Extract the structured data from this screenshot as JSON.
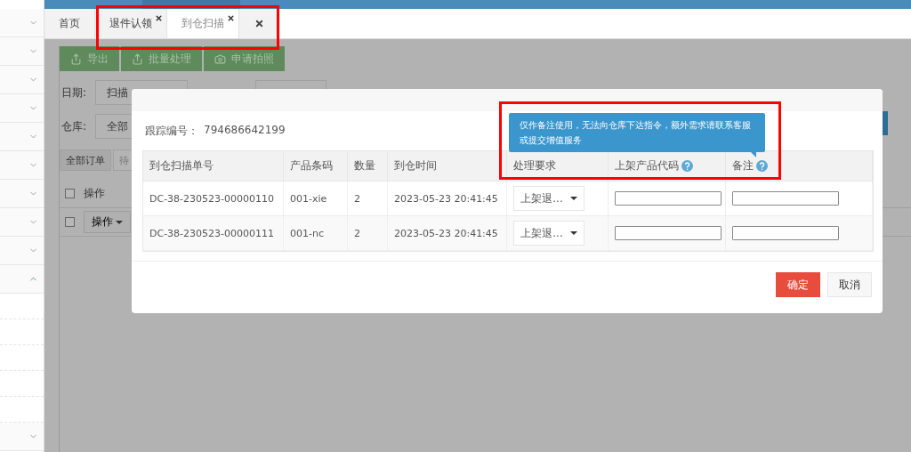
{
  "sidebar": {
    "items": [
      {
        "expanded": false
      },
      {
        "expanded": false
      },
      {
        "expanded": false
      },
      {
        "expanded": false
      },
      {
        "expanded": false
      },
      {
        "expanded": false
      },
      {
        "expanded": false
      },
      {
        "expanded": false
      },
      {
        "expanded": false
      },
      {
        "expanded": true
      },
      {
        "expanded": false
      }
    ]
  },
  "tabs": [
    {
      "label": "首页",
      "selected": false,
      "closable": false
    },
    {
      "label": "退件认领",
      "selected": false,
      "closable": true
    },
    {
      "label": "到仓扫描",
      "selected": true,
      "closable": true
    }
  ],
  "close_all_tab": true,
  "toolbar": [
    {
      "label": "导出"
    },
    {
      "label": "批量处理"
    },
    {
      "label": "申请拍照"
    }
  ],
  "filters": {
    "date_label": "日期:",
    "date_value": "扫描",
    "warehouse_label": "仓库:",
    "warehouse_value": "全部"
  },
  "order_tabs": [
    {
      "label": "全部订单",
      "selected": true
    },
    {
      "label": "待",
      "selected": false
    }
  ],
  "list": {
    "header": "操作",
    "header_checked": false,
    "row_action": "操作",
    "row_checked": false
  },
  "dialog": {
    "tracking_label": "跟踪编号：",
    "tracking_value": "794686642199",
    "tooltip": "仅作备注使用，无法向仓库下达指令，额外需求请联系客服或提交增值服务",
    "columns": [
      {
        "label": "到仓扫描单号",
        "help": false
      },
      {
        "label": "产品条码",
        "help": false
      },
      {
        "label": "数量",
        "help": false
      },
      {
        "label": "到仓时间",
        "help": false
      },
      {
        "label": "处理要求",
        "help": false
      },
      {
        "label": "上架产品代码",
        "help": true
      },
      {
        "label": "备注",
        "help": true
      }
    ],
    "rows": [
      {
        "scan_no": "DC-38-230523-00000110",
        "barcode": "001-xie",
        "qty": "2",
        "time": "2023-05-23 20:41:45",
        "request": "上架退..."
      },
      {
        "scan_no": "DC-38-230523-00000111",
        "barcode": "001-nc",
        "qty": "2",
        "time": "2023-05-23 20:41:45",
        "request": "上架退..."
      }
    ],
    "buttons": [
      {
        "label": "确定",
        "kind": "primary"
      },
      {
        "label": "取消",
        "kind": "default"
      }
    ]
  }
}
